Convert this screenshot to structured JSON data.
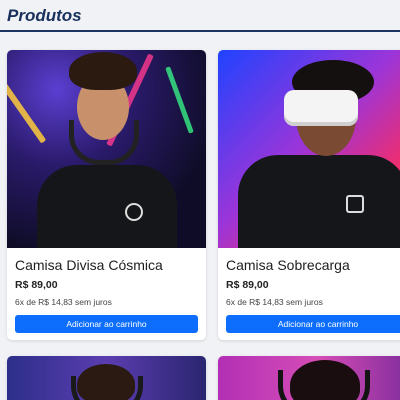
{
  "page": {
    "title": "Produtos"
  },
  "products": [
    {
      "name": "Camisa Divisa Cósmica",
      "price": "R$ 89,00",
      "installments": "6x de R$ 14,83 sem juros",
      "button_label": "Adicionar ao carrinho",
      "image_icon": "product-photo-gamer-headphones"
    },
    {
      "name": "Camisa Sobrecarga",
      "price": "R$ 89,00",
      "installments": "6x de R$ 14,83 sem juros",
      "button_label": "Adicionar ao carrinho",
      "image_icon": "product-photo-vr-headset"
    },
    {
      "image_icon": "product-photo-gamer"
    },
    {
      "image_icon": "product-photo-headset-microphone"
    }
  ],
  "colors": {
    "title": "#19315c",
    "accent_button": "#0d6efd",
    "background": "#f0f2f5"
  }
}
